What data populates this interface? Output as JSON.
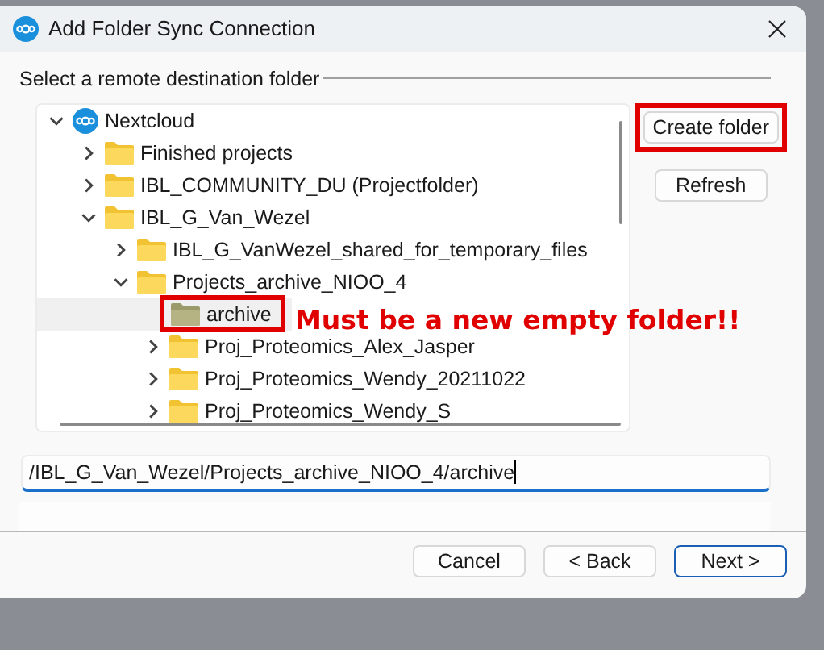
{
  "window": {
    "title": "Add Folder Sync Connection"
  },
  "group_label": "Select a remote destination folder",
  "tree": [
    {
      "label": "Nextcloud",
      "kind": "account",
      "has_children": true,
      "expanded": true,
      "selected": false,
      "highlighted": false,
      "children": [
        {
          "label": "Finished projects",
          "kind": "folder",
          "has_children": true,
          "expanded": false,
          "selected": false,
          "highlighted": false
        },
        {
          "label": "IBL_COMMUNITY_DU (Projectfolder)",
          "kind": "folder",
          "has_children": true,
          "expanded": false,
          "selected": false,
          "highlighted": false
        },
        {
          "label": "IBL_G_Van_Wezel",
          "kind": "folder",
          "has_children": true,
          "expanded": true,
          "selected": false,
          "highlighted": false,
          "children": [
            {
              "label": "IBL_G_VanWezel_shared_for_temporary_files",
              "kind": "folder",
              "has_children": true,
              "expanded": false,
              "selected": false,
              "highlighted": false
            },
            {
              "label": "Projects_archive_NIOO_4",
              "kind": "folder",
              "has_children": true,
              "expanded": true,
              "selected": false,
              "highlighted": false,
              "children": [
                {
                  "label": "archive",
                  "kind": "folder",
                  "has_children": false,
                  "selected": true,
                  "highlighted": true
                },
                {
                  "label": "Proj_Proteomics_Alex_Jasper",
                  "kind": "folder",
                  "has_children": true,
                  "expanded": false,
                  "selected": false,
                  "highlighted": false
                },
                {
                  "label": "Proj_Proteomics_Wendy_20211022",
                  "kind": "folder",
                  "has_children": true,
                  "expanded": false,
                  "selected": false,
                  "highlighted": false
                },
                {
                  "label": "Proj_Proteomics_Wendy_S",
                  "kind": "folder",
                  "has_children": true,
                  "expanded": false,
                  "selected": false,
                  "highlighted": false
                }
              ]
            }
          ]
        }
      ]
    }
  ],
  "side_buttons": [
    {
      "label": "Create folder",
      "highlighted": true
    },
    {
      "label": "Refresh",
      "highlighted": false
    }
  ],
  "annotation": {
    "text": "Must be a new empty folder!!"
  },
  "path_field": {
    "value": "/IBL_G_Van_Wezel/Projects_archive_NIOO_4/archive",
    "focused": true
  },
  "footer_buttons": [
    {
      "label": "Cancel",
      "default": false
    },
    {
      "label": "< Back",
      "default": false
    },
    {
      "label": "Next >",
      "default": true
    }
  ]
}
